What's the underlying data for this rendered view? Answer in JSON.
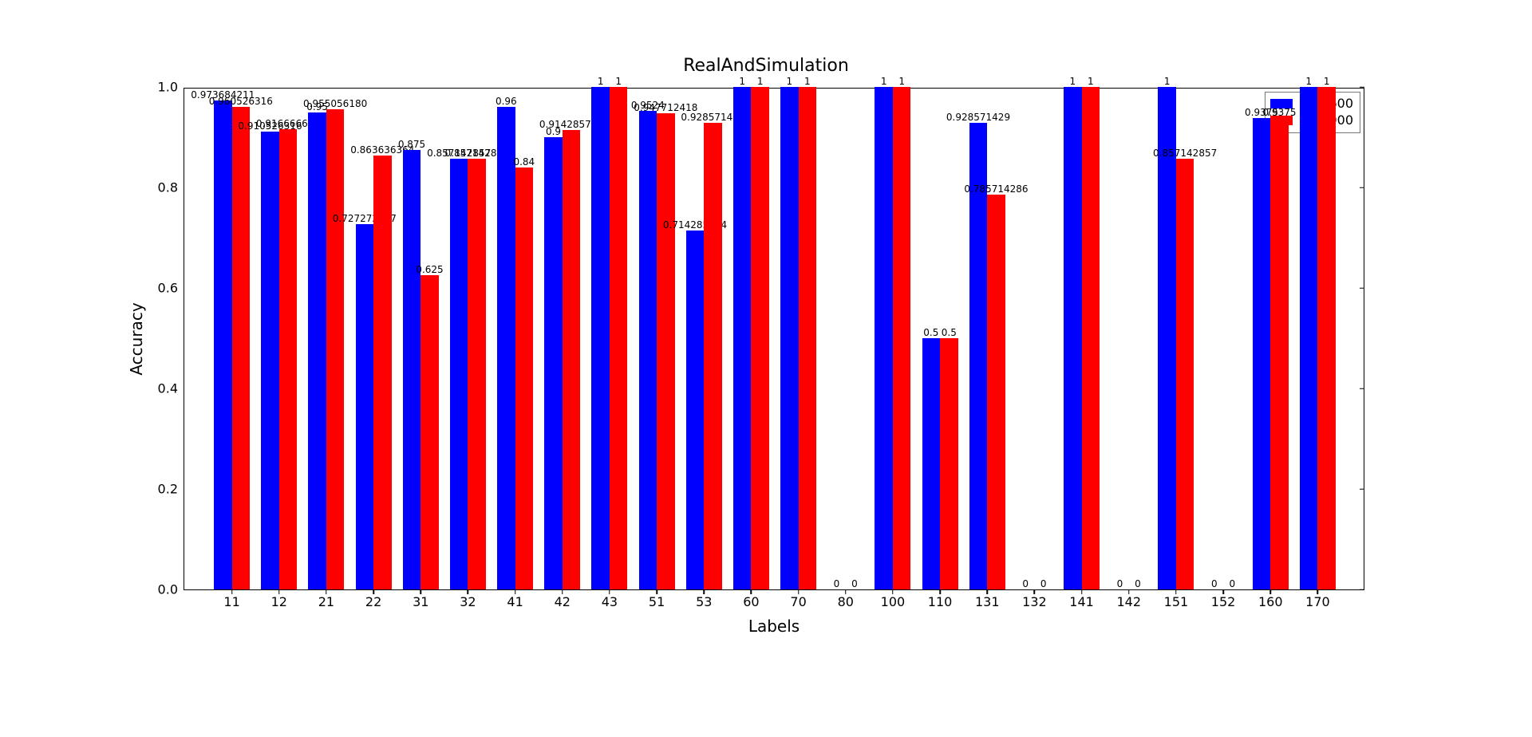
{
  "chart_data": {
    "type": "bar",
    "title": "RealAndSimulation",
    "xlabel": "Labels",
    "ylabel": "Accuracy",
    "ylim": [
      0,
      1
    ],
    "yticks": [
      0.0,
      0.2,
      0.4,
      0.6,
      0.8,
      1.0
    ],
    "categories": [
      "11",
      "12",
      "21",
      "22",
      "31",
      "32",
      "41",
      "42",
      "43",
      "51",
      "53",
      "60",
      "70",
      "80",
      "100",
      "110",
      "131",
      "132",
      "141",
      "142",
      "151",
      "152",
      "160",
      "170"
    ],
    "series": [
      {
        "name": "iter6600",
        "color": "#0000ff",
        "values": [
          0.973684211,
          0.910526316,
          0.95,
          0.727272727,
          0.875,
          0.857142857,
          0.96,
          0.9,
          1,
          0.952380952,
          0.714285714,
          1,
          1,
          0,
          1,
          0.5,
          0.928571429,
          0,
          1,
          0,
          1,
          0,
          0.9375,
          1
        ],
        "value_labels": [
          "0.973684211",
          "0.910526316",
          "0.95",
          "0.727272727",
          "0.875",
          "0.857142857",
          "0.96",
          "0.9",
          "1",
          "0.9524",
          "0.714285714",
          "1",
          "1",
          "0",
          "1",
          "0.5",
          "0.928571429",
          "0",
          "1",
          "0",
          "1",
          "0",
          "0.9375",
          "1"
        ]
      },
      {
        "name": "iter7000",
        "color": "#ff0000",
        "values": [
          0.960526316,
          0.916666667,
          0.95505618,
          0.863636364,
          0.625,
          0.857142857,
          0.84,
          0.914285714,
          1,
          0.947712418,
          0.928571429,
          1,
          1,
          0,
          1,
          0.5,
          0.785714286,
          0,
          1,
          0,
          0.857142857,
          0,
          0.9375,
          1
        ],
        "value_labels": [
          "0.960526316",
          "0.916666667",
          "0.955056180",
          "0.863636364",
          "0.625",
          "0.857142857",
          "0.84",
          "0.914285714",
          "1",
          "0.947712418",
          "0.928571429",
          "1",
          "1",
          "0",
          "1",
          "0.5",
          "0.785714286",
          "0",
          "1",
          "0",
          "0.857142857",
          "0",
          "0.9375",
          "1"
        ]
      }
    ],
    "legend_position": "upper right"
  }
}
